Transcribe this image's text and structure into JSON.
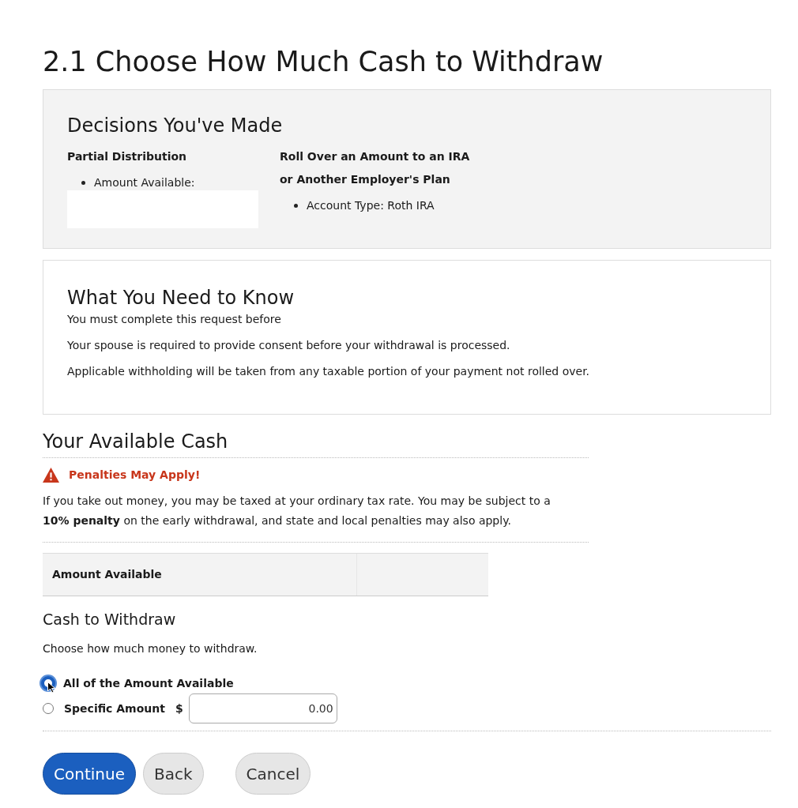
{
  "title": "2.1 Choose How Much Cash to Withdraw",
  "decisions": {
    "heading": "Decisions You've Made",
    "columns": [
      {
        "lines": [
          "Partial Distribution"
        ],
        "bullets": [
          "Amount Available:"
        ],
        "blank_value": true
      },
      {
        "lines": [
          "Roll Over an Amount to an IRA",
          "or Another Employer's Plan"
        ],
        "bullets": [
          "Account Type: Roth IRA"
        ]
      }
    ]
  },
  "need_to_know": {
    "heading": "What You Need to Know",
    "paragraphs": [
      "You must complete this request before",
      "Your spouse is required to provide consent before your withdrawal is processed.",
      "Applicable withholding will be taken from any taxable portion of your payment not rolled over."
    ]
  },
  "available_cash": {
    "heading": "Your Available Cash",
    "warning": "Penalties May Apply!",
    "text": "If you take out money, you may be taxed at your ordinary tax rate. You may be subject to a **10% penalty** on the early withdrawal, and state and local penalties may also apply.",
    "table": {
      "columns": [
        "Amount Available"
      ]
    }
  },
  "cash_to_withdraw": {
    "heading": "Cash to Withdraw",
    "instruction": "Choose how much money to withdraw.",
    "options": [
      {
        "label": "All of the Amount Available",
        "selected": true
      },
      {
        "label": "Specific Amount",
        "selected": false,
        "currency": "$",
        "value": "0.00"
      }
    ]
  },
  "buttons": [
    {
      "label": "Continue",
      "kind": "primary"
    },
    {
      "label": "Back",
      "kind": "secondary"
    },
    {
      "label": "Cancel",
      "kind": "secondary"
    }
  ]
}
